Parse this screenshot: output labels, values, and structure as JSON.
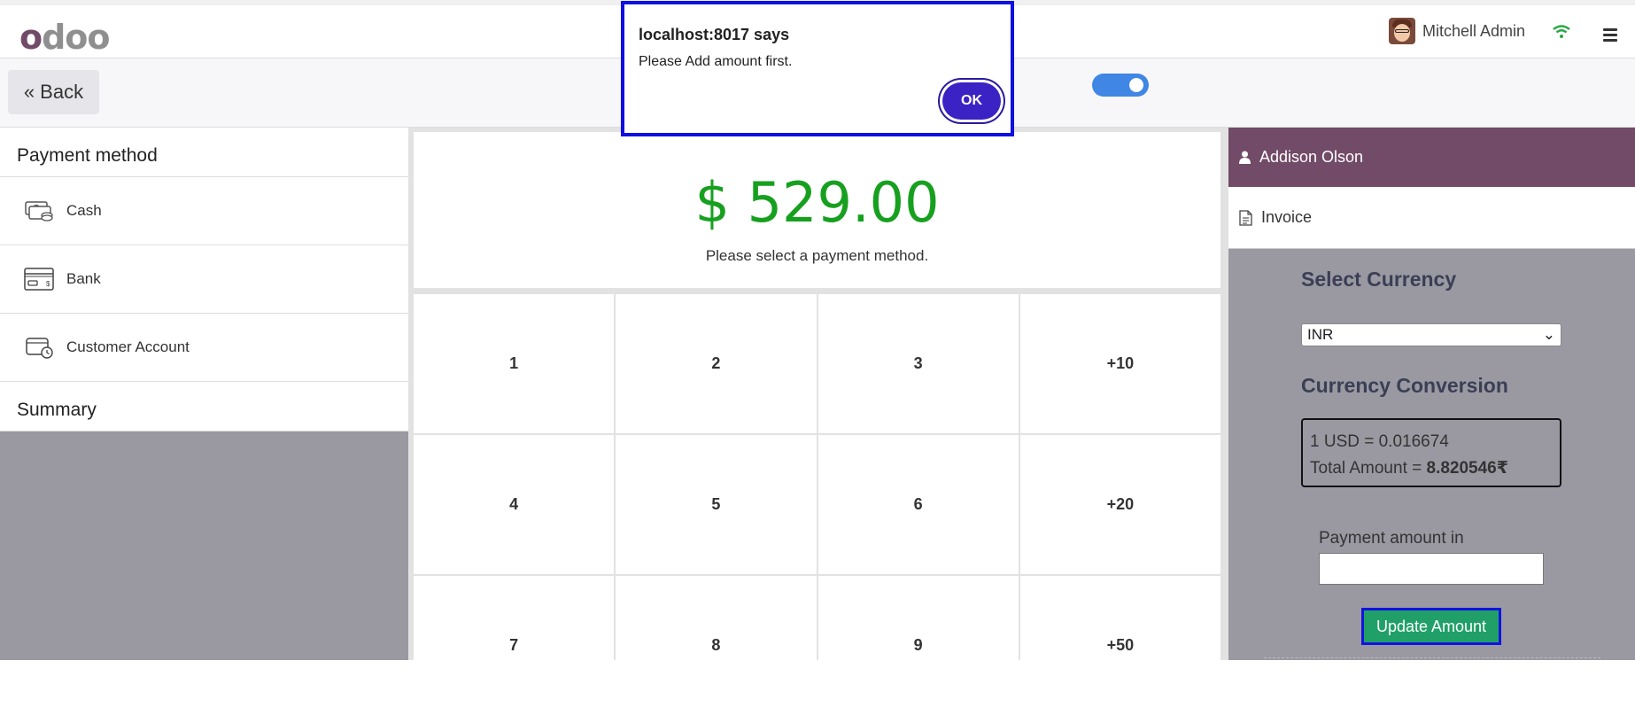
{
  "header": {
    "logo_text": "odoo",
    "user_name": "Mitchell Admin",
    "icons": [
      "avatar",
      "wifi-icon",
      "menu-icon"
    ]
  },
  "subbar": {
    "back_label": "Back",
    "toggle_on": true
  },
  "payment": {
    "title": "Payment method",
    "methods": [
      {
        "label": "Cash",
        "icon": "cash-icon"
      },
      {
        "label": "Bank",
        "icon": "bank-card-icon"
      },
      {
        "label": "Customer Account",
        "icon": "wallet-clock-icon"
      }
    ],
    "summary_label": "Summary"
  },
  "amount": {
    "value": "$ 529.00",
    "message": "Please select a payment method."
  },
  "keypad": [
    "1",
    "2",
    "3",
    "+10",
    "4",
    "5",
    "6",
    "+20",
    "7",
    "8",
    "9",
    "+50"
  ],
  "right": {
    "customer": "Addison Olson",
    "invoice": "Invoice",
    "select_currency_title": "Select Currency",
    "currency_selected": "INR",
    "conversion_title": "Currency Conversion",
    "rate_text": "1 USD = 0.016674",
    "total_prefix": "Total Amount = ",
    "total_value": "8.820546₹",
    "payment_amount_label": "Payment amount in",
    "payment_amount_value": "",
    "update_button": "Update Amount"
  },
  "dialog": {
    "title": "localhost:8017 says",
    "message": "Please Add amount first.",
    "ok_label": "OK"
  },
  "colors": {
    "brand": "#714b67",
    "amount_green": "#17a01f",
    "toggle_blue": "#3f86e5",
    "update_green": "#20a068",
    "dialog_ok": "#3b22c4"
  }
}
